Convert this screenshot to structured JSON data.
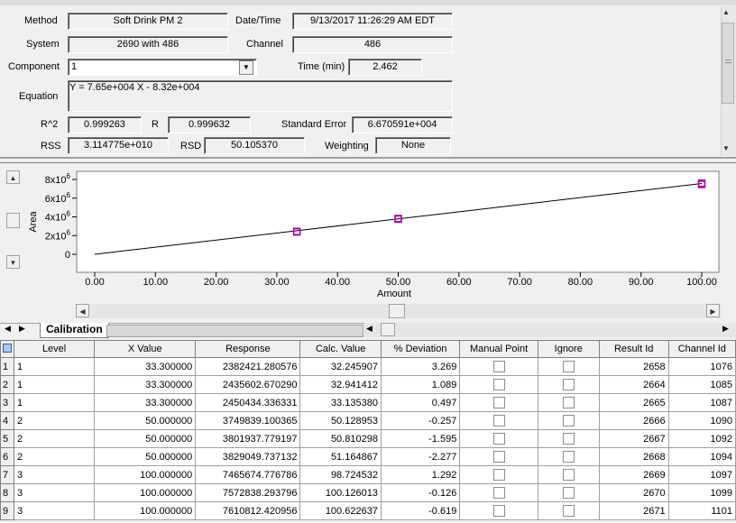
{
  "form": {
    "method_label": "Method",
    "method_value": "Soft Drink PM 2",
    "datetime_label": "Date/Time",
    "datetime_value": "9/13/2017 11:26:29 AM EDT",
    "system_label": "System",
    "system_value": "2690 with 486",
    "channel_label": "Channel",
    "channel_value": "486",
    "component_label": "Component",
    "component_value": "1",
    "time_label": "Time (min)",
    "time_value": "2.462",
    "equation_label": "Equation",
    "equation_value": "Y = 7.65e+004 X - 8.32e+004",
    "r2_label": "R^2",
    "r2_value": "0.999263",
    "r_label": "R",
    "r_value": "0.999632",
    "stderr_label": "Standard Error",
    "stderr_value": "6.670591e+004",
    "rss_label": "RSS",
    "rss_value": "3.114775e+010",
    "rsd_label": "RSD",
    "rsd_value": "50.105370",
    "weighting_label": "Weighting",
    "weighting_value": "None"
  },
  "tab": {
    "label": "Calibration"
  },
  "chart_data": {
    "type": "scatter",
    "xlabel": "Amount",
    "ylabel": "Area",
    "xlim": [
      0,
      100
    ],
    "ylim": [
      0,
      8000000
    ],
    "x_ticks": [
      "0.00",
      "10.00",
      "20.00",
      "30.00",
      "40.00",
      "50.00",
      "60.00",
      "70.00",
      "80.00",
      "90.00",
      "100.00"
    ],
    "y_ticks": [
      {
        "value": 0,
        "base": "0",
        "exp": ""
      },
      {
        "value": 2000000,
        "base": "2x10",
        "exp": "6"
      },
      {
        "value": 4000000,
        "base": "4x10",
        "exp": "6"
      },
      {
        "value": 6000000,
        "base": "6x10",
        "exp": "6"
      },
      {
        "value": 8000000,
        "base": "8x10",
        "exp": "6"
      }
    ],
    "fit_line": {
      "slope": 76500,
      "intercept": -83200
    },
    "points": [
      {
        "x": 33.3,
        "y": 2382421.280576
      },
      {
        "x": 33.3,
        "y": 2435602.67029
      },
      {
        "x": 33.3,
        "y": 2450434.336331
      },
      {
        "x": 50.0,
        "y": 3749839.100365
      },
      {
        "x": 50.0,
        "y": 3801937.779197
      },
      {
        "x": 50.0,
        "y": 3829049.737132
      },
      {
        "x": 100.0,
        "y": 7465674.776786
      },
      {
        "x": 100.0,
        "y": 7572838.293796
      },
      {
        "x": 100.0,
        "y": 7610812.420956
      }
    ],
    "grid": false,
    "point_color": "#b000b0"
  },
  "table": {
    "corner_icon": "grid-icon",
    "columns": [
      "Level",
      "X Value",
      "Response",
      "Calc. Value",
      "% Deviation",
      "Manual Point",
      "Ignore",
      "Result Id",
      "Channel Id"
    ],
    "rows": [
      {
        "n": "1",
        "level": "1",
        "x": "33.300000",
        "resp": "2382421.280576",
        "calc": "32.245907",
        "dev": "3.269",
        "rid": "2658",
        "cid": "1076"
      },
      {
        "n": "2",
        "level": "1",
        "x": "33.300000",
        "resp": "2435602.670290",
        "calc": "32.941412",
        "dev": "1.089",
        "rid": "2664",
        "cid": "1085"
      },
      {
        "n": "3",
        "level": "1",
        "x": "33.300000",
        "resp": "2450434.336331",
        "calc": "33.135380",
        "dev": "0.497",
        "rid": "2665",
        "cid": "1087"
      },
      {
        "n": "4",
        "level": "2",
        "x": "50.000000",
        "resp": "3749839.100365",
        "calc": "50.128953",
        "dev": "-0.257",
        "rid": "2666",
        "cid": "1090"
      },
      {
        "n": "5",
        "level": "2",
        "x": "50.000000",
        "resp": "3801937.779197",
        "calc": "50.810298",
        "dev": "-1.595",
        "rid": "2667",
        "cid": "1092"
      },
      {
        "n": "6",
        "level": "2",
        "x": "50.000000",
        "resp": "3829049.737132",
        "calc": "51.164867",
        "dev": "-2.277",
        "rid": "2668",
        "cid": "1094"
      },
      {
        "n": "7",
        "level": "3",
        "x": "100.000000",
        "resp": "7465674.776786",
        "calc": "98.724532",
        "dev": "1.292",
        "rid": "2669",
        "cid": "1097"
      },
      {
        "n": "8",
        "level": "3",
        "x": "100.000000",
        "resp": "7572838.293796",
        "calc": "100.126013",
        "dev": "-0.126",
        "rid": "2670",
        "cid": "1099"
      },
      {
        "n": "9",
        "level": "3",
        "x": "100.000000",
        "resp": "7610812.420956",
        "calc": "100.622637",
        "dev": "-0.619",
        "rid": "2671",
        "cid": "1101"
      }
    ]
  }
}
